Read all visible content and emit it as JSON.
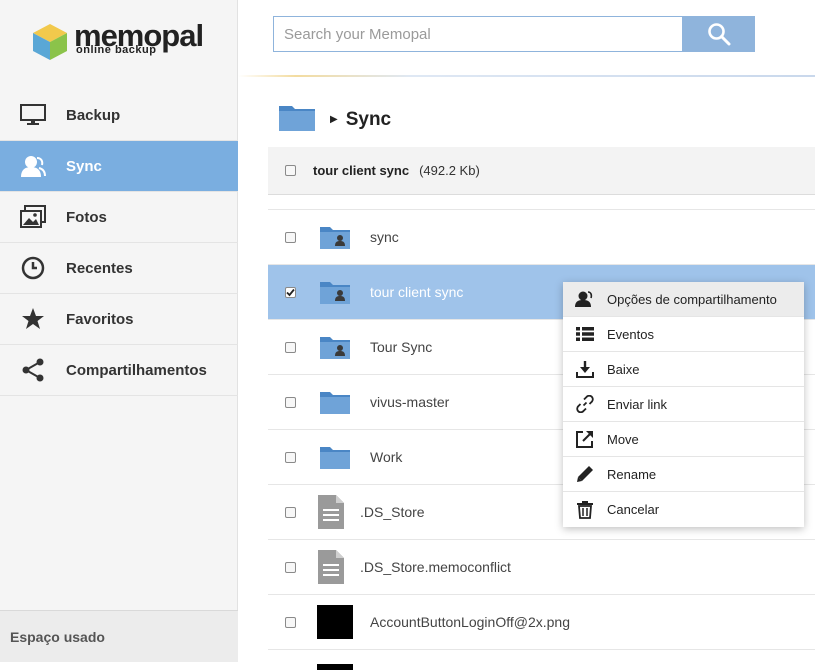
{
  "brand": {
    "name": "memopal",
    "tagline": "online backup"
  },
  "sidebar": {
    "items": [
      {
        "label": "Backup",
        "icon": "monitor-icon",
        "active": false
      },
      {
        "label": "Sync",
        "icon": "user-icon",
        "active": true
      },
      {
        "label": "Fotos",
        "icon": "photos-icon",
        "active": false
      },
      {
        "label": "Recentes",
        "icon": "clock-icon",
        "active": false
      },
      {
        "label": "Favoritos",
        "icon": "star-icon",
        "active": false
      },
      {
        "label": "Compartilhamentos",
        "icon": "share-icon",
        "active": false
      }
    ],
    "usage_label": "Espaço usado"
  },
  "search": {
    "placeholder": "Search your Memopal",
    "value": "",
    "button_icon": "search-icon"
  },
  "breadcrumb": {
    "title": "Sync"
  },
  "selection": {
    "name": "tour client sync",
    "size": "(492.2 Kb)"
  },
  "files": [
    {
      "name": "sync",
      "type": "shared-folder",
      "checked": false
    },
    {
      "name": "tour client sync",
      "type": "shared-folder",
      "checked": true
    },
    {
      "name": "Tour Sync",
      "type": "shared-folder",
      "checked": false
    },
    {
      "name": "vivus-master",
      "type": "folder",
      "checked": false
    },
    {
      "name": "Work",
      "type": "folder",
      "checked": false
    },
    {
      "name": ".DS_Store",
      "type": "document",
      "checked": false
    },
    {
      "name": ".DS_Store.memoconflict",
      "type": "document",
      "checked": false
    },
    {
      "name": "AccountButtonLoginOff@2x.png",
      "type": "image",
      "checked": false
    }
  ],
  "context_menu": {
    "items": [
      {
        "label": "Opções de compartilhamento",
        "icon": "share-user-icon"
      },
      {
        "label": "Eventos",
        "icon": "list-icon"
      },
      {
        "label": "Baixe",
        "icon": "download-icon"
      },
      {
        "label": "Enviar link",
        "icon": "link-icon"
      },
      {
        "label": "Move",
        "icon": "move-icon"
      },
      {
        "label": "Rename",
        "icon": "pencil-icon"
      },
      {
        "label": "Cancelar",
        "icon": "trash-icon"
      }
    ]
  },
  "colors": {
    "accent": "#7aaee0",
    "selected_row": "#9fc3ea",
    "folder": "#6fa3d8"
  }
}
